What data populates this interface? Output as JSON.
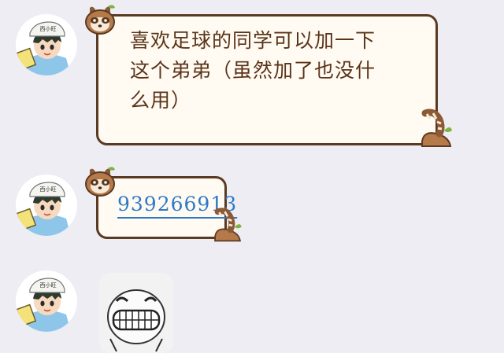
{
  "messages": [
    {
      "type": "text",
      "text": "喜欢足球的同学可以加一下\n这个弟弟（虽然加了也没什\n么用）"
    },
    {
      "type": "link",
      "text": "939266913"
    },
    {
      "type": "sticker",
      "icon": "grinning-face-sticker-icon"
    }
  ],
  "avatar": {
    "icon": "boy-cap-avatar-icon",
    "cap_text": "西小旺"
  },
  "colors": {
    "background": "#ededf3",
    "bubble_fill": "#fffaf2",
    "bubble_border": "#5a3a22",
    "text": "#5b3418",
    "link": "#2d79c7"
  }
}
